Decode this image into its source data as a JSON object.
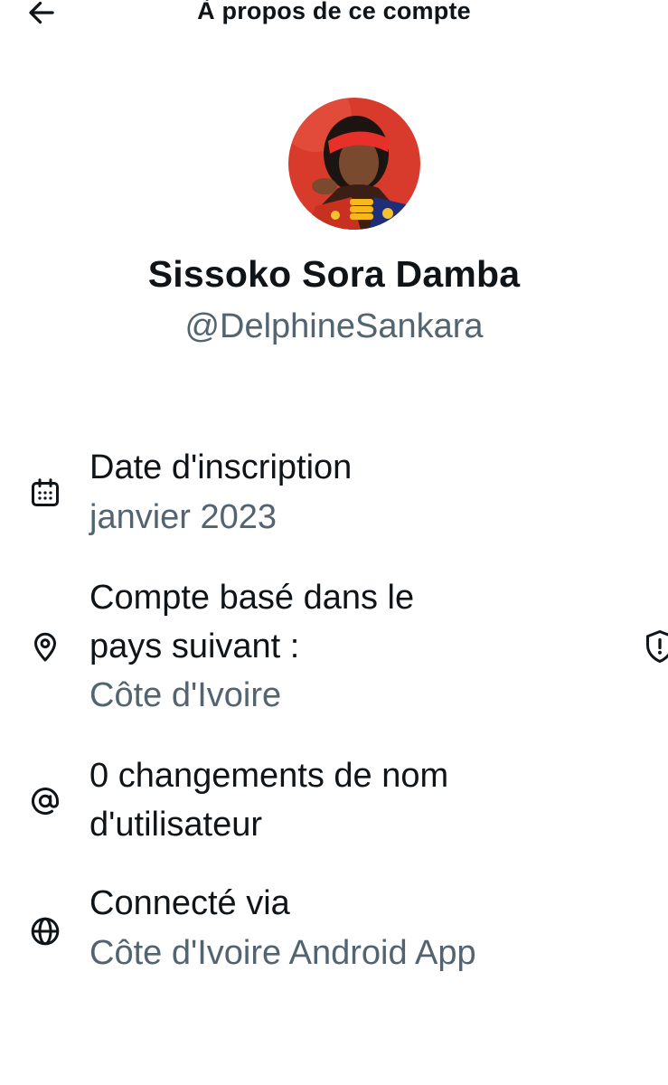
{
  "header": {
    "title": "À propos de ce compte",
    "back_icon": "arrow-left-icon"
  },
  "profile": {
    "display_name": "Sissoko Sora Damba",
    "handle": "@DelphineSankara",
    "avatar_bg": "#d83a2c"
  },
  "details": [
    {
      "icon": "calendar-icon",
      "title": "Date d'inscription",
      "value": "janvier 2023"
    },
    {
      "icon": "location-pin-icon",
      "title_line1": "Compte basé dans le",
      "title_line2": "pays suivant :",
      "value": "Côte d'Ivoire",
      "side_icon": "shield-alert-icon"
    },
    {
      "icon": "at-sign-icon",
      "title_line1": "0 changements de nom",
      "title_line2": "d'utilisateur"
    },
    {
      "icon": "globe-icon",
      "title": "Connecté via",
      "value": "Côte d'Ivoire Android App"
    }
  ],
  "colors": {
    "text_primary": "#0f1419",
    "text_secondary": "#536471",
    "background": "#ffffff"
  }
}
